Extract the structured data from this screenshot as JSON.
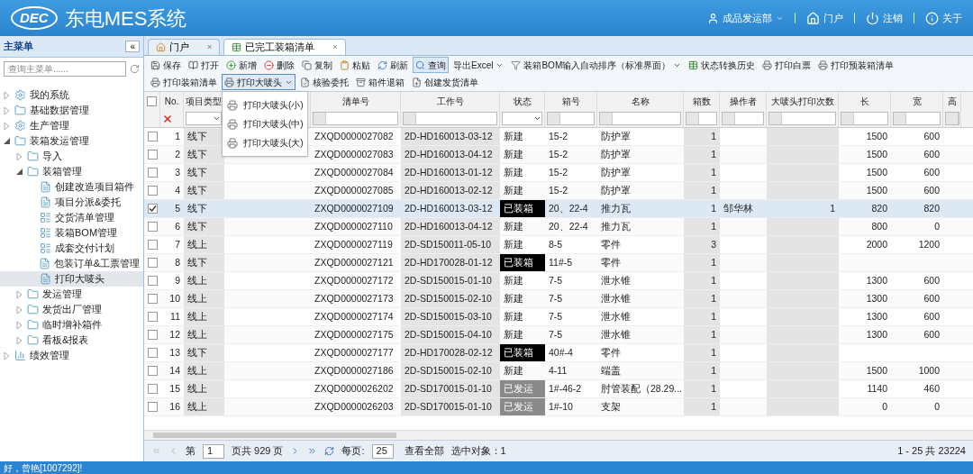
{
  "header": {
    "logo": "DEC",
    "title": "东电MES系统",
    "user": "成品发运部",
    "links": [
      "门户",
      "注销",
      "关于"
    ]
  },
  "sidebar": {
    "title": "主菜单",
    "collapse": "«",
    "search_placeholder": "查询主菜单......",
    "tree": [
      {
        "label": "我的系统",
        "kind": "gear",
        "expanded": false,
        "selected": false
      },
      {
        "label": "基础数据管理",
        "kind": "folder",
        "expanded": false,
        "selected": false
      },
      {
        "label": "生产管理",
        "kind": "gear",
        "expanded": false,
        "selected": false
      },
      {
        "label": "装箱发运管理",
        "kind": "folder",
        "expanded": true,
        "selected": false,
        "children": [
          {
            "label": "导入",
            "kind": "folder",
            "expanded": false,
            "selected": false
          },
          {
            "label": "装箱管理",
            "kind": "folder",
            "expanded": true,
            "selected": false,
            "children": [
              {
                "label": "创建改造项目箱件",
                "kind": "page",
                "selected": false
              },
              {
                "label": "项目分派&委托",
                "kind": "page",
                "selected": false
              },
              {
                "label": "交货清单管理",
                "kind": "list",
                "selected": false
              },
              {
                "label": "装箱BOM管理",
                "kind": "list",
                "selected": false
              },
              {
                "label": "成套交付计划",
                "kind": "list",
                "selected": false
              },
              {
                "label": "包装订单&工票管理",
                "kind": "page",
                "selected": false
              },
              {
                "label": "打印大唛头",
                "kind": "page",
                "selected": true
              }
            ]
          },
          {
            "label": "发运管理",
            "kind": "folder",
            "expanded": false,
            "selected": false
          },
          {
            "label": "发货出厂管理",
            "kind": "folder",
            "expanded": false,
            "selected": false
          },
          {
            "label": "临时增补箱件",
            "kind": "folder",
            "expanded": false,
            "selected": false
          },
          {
            "label": "看板&报表",
            "kind": "folder",
            "expanded": false,
            "selected": false
          }
        ]
      },
      {
        "label": "绩效管理",
        "kind": "report",
        "expanded": false,
        "selected": false
      }
    ]
  },
  "tabs": [
    {
      "label": "门户",
      "selected": false,
      "close": "×"
    },
    {
      "label": "已完工装箱清单",
      "selected": true,
      "close": "×"
    }
  ],
  "toolbar": [
    [
      {
        "label": "保存",
        "selected": false
      },
      {
        "label": "打开",
        "selected": false
      },
      {
        "label": "新增",
        "selected": false
      },
      {
        "label": "删除",
        "selected": false
      },
      {
        "label": "复制",
        "selected": false
      },
      {
        "label": "粘贴",
        "selected": false
      },
      {
        "label": "刷新",
        "selected": false
      },
      {
        "label": "查询",
        "selected": true
      },
      {
        "label": "导出Excel",
        "selected": false,
        "dropdown": true
      },
      {
        "label": "装箱BOM输入自动排序（标准界面）",
        "selected": false,
        "dropdown": true
      },
      {
        "label": "状态转换历史",
        "selected": false
      },
      {
        "label": "打印白票",
        "selected": false
      },
      {
        "label": "打印预装箱清单",
        "selected": false
      }
    ],
    [
      {
        "label": "打印装箱清单",
        "selected": false
      },
      {
        "label": "打印大唛头",
        "selected": true,
        "dropdown": true,
        "expanded": true,
        "menu": [
          "打印大唛头(小)",
          "打印大唛头(中)",
          "打印大唛头(大)"
        ]
      },
      {
        "label": "核验委托",
        "selected": false
      },
      {
        "label": "箱件退箱",
        "selected": false
      },
      {
        "label": "创建发货清单",
        "selected": false
      }
    ]
  ],
  "table": {
    "select_all": {
      "checked": false
    },
    "columns": [
      {
        "label": "No.",
        "kind": "number",
        "filter": {
          "kind": "clear"
        },
        "shaded": false
      },
      {
        "label": "项目类型",
        "kind": "text",
        "filter": {
          "kind": "select"
        },
        "shaded": true
      },
      {
        "kind": "text",
        "shaded": false
      },
      {
        "label": "清单号",
        "kind": "text",
        "filter": {
          "kind": "text"
        },
        "shaded": false
      },
      {
        "label": "工作号",
        "kind": "text",
        "filter": {
          "kind": "text"
        },
        "shaded": true
      },
      {
        "label": "状态",
        "kind": "status",
        "filter": {
          "kind": "select"
        },
        "shaded": false
      },
      {
        "label": "箱号",
        "kind": "text",
        "filter": {
          "kind": "text"
        },
        "shaded": false
      },
      {
        "label": "名称",
        "kind": "text",
        "filter": {
          "kind": "text"
        },
        "shaded": false
      },
      {
        "label": "箱数",
        "kind": "number",
        "filter": {
          "kind": "text"
        },
        "shaded": true
      },
      {
        "label": "操作者",
        "kind": "text",
        "filter": {
          "kind": "text"
        },
        "shaded": false
      },
      {
        "label": "大唛头打印次数",
        "kind": "number",
        "filter": {
          "kind": "text"
        },
        "shaded": true
      },
      {
        "label": "长",
        "kind": "number",
        "filter": {
          "kind": "text"
        },
        "shaded": false
      },
      {
        "label": "宽",
        "kind": "number",
        "filter": {
          "kind": "text"
        },
        "shaded": false
      },
      {
        "label": "高",
        "kind": "number",
        "filter": {
          "kind": "text"
        },
        "shaded": false
      }
    ],
    "rows": [
      {
        "selected": false,
        "cells": [
          "1",
          "线下",
          null,
          "ZXQD0000027082",
          "2D-HD160013-03-12",
          {
            "text": "新建"
          },
          "15-2",
          "防护罩",
          "1",
          null,
          null,
          "1500",
          "600",
          null
        ]
      },
      {
        "selected": false,
        "cells": [
          "2",
          "线下",
          null,
          "ZXQD0000027083",
          "2D-HD160013-04-12",
          {
            "text": "新建"
          },
          "15-2",
          "防护罩",
          "1",
          null,
          null,
          "1500",
          "600",
          null
        ]
      },
      {
        "selected": false,
        "cells": [
          "3",
          "线下",
          null,
          "ZXQD0000027084",
          "2D-HD160013-01-12",
          {
            "text": "新建"
          },
          "15-2",
          "防护罩",
          "1",
          null,
          null,
          "1500",
          "600",
          null
        ]
      },
      {
        "selected": false,
        "cells": [
          "4",
          "线下",
          null,
          "ZXQD0000027085",
          "2D-HD160013-02-12",
          {
            "text": "新建"
          },
          "15-2",
          "防护罩",
          "1",
          null,
          null,
          "1500",
          "600",
          null
        ]
      },
      {
        "selected": true,
        "cells": [
          "5",
          "线下",
          null,
          "ZXQD0000027109",
          "2D-HD160013-03-12",
          {
            "text": "已装箱",
            "color": "#000000"
          },
          "20、22-4",
          "推力瓦",
          "1",
          "邹华林",
          "1",
          "820",
          "820",
          null
        ]
      },
      {
        "selected": false,
        "cells": [
          "6",
          "线下",
          null,
          "ZXQD0000027110",
          "2D-HD160013-04-12",
          {
            "text": "新建"
          },
          "20、22-4",
          "推力瓦",
          "1",
          null,
          null,
          "800",
          "0",
          null
        ]
      },
      {
        "selected": false,
        "cells": [
          "7",
          "线上",
          null,
          "ZXQD0000027119",
          "2D-SD150011-05-10",
          {
            "text": "新建"
          },
          "8-5",
          "零件",
          "3",
          null,
          null,
          "2000",
          "1200",
          null
        ]
      },
      {
        "selected": false,
        "cells": [
          "8",
          "线下",
          null,
          "ZXQD0000027121",
          "2D-HD170028-01-12",
          {
            "text": "已装箱",
            "color": "#000000"
          },
          "11#-5",
          "零件",
          "1",
          null,
          null,
          null,
          null,
          null
        ]
      },
      {
        "selected": false,
        "cells": [
          "9",
          "线上",
          null,
          "ZXQD0000027172",
          "2D-SD150015-01-10",
          {
            "text": "新建"
          },
          "7-5",
          "泄水锥",
          "1",
          null,
          null,
          "1300",
          "600",
          null
        ]
      },
      {
        "selected": false,
        "cells": [
          "10",
          "线上",
          null,
          "ZXQD0000027173",
          "2D-SD150015-02-10",
          {
            "text": "新建"
          },
          "7-5",
          "泄水锥",
          "1",
          null,
          null,
          "1300",
          "600",
          null
        ]
      },
      {
        "selected": false,
        "cells": [
          "11",
          "线上",
          null,
          "ZXQD0000027174",
          "2D-SD150015-03-10",
          {
            "text": "新建"
          },
          "7-5",
          "泄水锥",
          "1",
          null,
          null,
          "1300",
          "600",
          null
        ]
      },
      {
        "selected": false,
        "cells": [
          "12",
          "线上",
          null,
          "ZXQD0000027175",
          "2D-SD150015-04-10",
          {
            "text": "新建"
          },
          "7-5",
          "泄水锥",
          "1",
          null,
          null,
          "1300",
          "600",
          null
        ]
      },
      {
        "selected": false,
        "cells": [
          "13",
          "线下",
          null,
          "ZXQD0000027177",
          "2D-HD170028-02-12",
          {
            "text": "已装箱",
            "color": "#000000"
          },
          "40#-4",
          "零件",
          "1",
          null,
          null,
          null,
          null,
          null
        ]
      },
      {
        "selected": false,
        "cells": [
          "14",
          "线上",
          null,
          "ZXQD0000027186",
          "2D-SD150015-02-10",
          {
            "text": "新建"
          },
          "4-11",
          "端盖",
          "1",
          null,
          null,
          "1500",
          "1000",
          null
        ]
      },
      {
        "selected": false,
        "cells": [
          "15",
          "线上",
          null,
          "ZXQD0000026202",
          "2D-SD170015-01-10",
          {
            "text": "已发运",
            "color": "#8a8a8a"
          },
          "1#-46-2",
          "肘管装配（28.29...",
          "1",
          null,
          null,
          "1140",
          "460",
          null
        ]
      },
      {
        "selected": false,
        "cells": [
          "16",
          "线上",
          null,
          "ZXQD0000026203",
          "2D-SD170015-01-10",
          {
            "text": "已发运",
            "color": "#8a8a8a"
          },
          "1#-10",
          "支架",
          "1",
          null,
          null,
          "0",
          "0",
          null
        ]
      }
    ]
  },
  "pager": {
    "page_prefix": "第",
    "page": "1",
    "page_suffix": "页共 929 页",
    "per_page_label": "每页:",
    "per_page": "25",
    "view_all": "查看全部",
    "selected_count": "选中对象：1",
    "range": "1 - 25 共 23224"
  },
  "status_bar": "好，曾艳[1007292]!"
}
